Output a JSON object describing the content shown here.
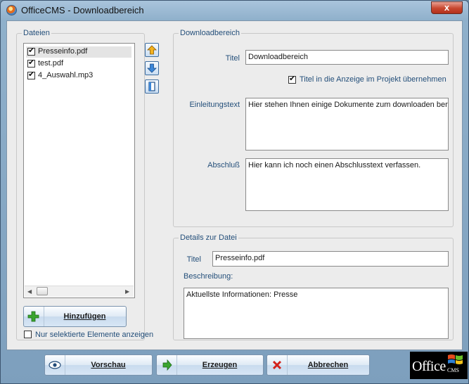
{
  "window": {
    "title": "OfficeCMS - Downloadbereich",
    "close_glyph": "x"
  },
  "files_group": {
    "label": "Dateien",
    "items": [
      {
        "name": "Presseinfo.pdf",
        "checked": true,
        "selected": true
      },
      {
        "name": "test.pdf",
        "checked": true,
        "selected": false
      },
      {
        "name": "4_Auswahl.mp3",
        "checked": true,
        "selected": false
      }
    ],
    "add_button": "Hinzufügen",
    "only_selected_label": "Nur selektierte Elemente anzeigen",
    "only_selected_checked": false,
    "icons": [
      "arrow-up-icon",
      "arrow-down-icon",
      "page-icon"
    ]
  },
  "download_group": {
    "label": "Downloadbereich",
    "title_label": "Titel",
    "title_value": "Downloadbereich",
    "take_title_label": "Titel in die Anzeige im Projekt übernehmen",
    "take_title_checked": true,
    "intro_label": "Einleitungstext",
    "intro_value": "Hier stehen Ihnen einige Dokumente zum downloaden bereit",
    "closing_label": "Abschluß",
    "closing_value": "Hier kann ich noch einen Abschlusstext verfassen."
  },
  "details_group": {
    "label": "Details zur Datei",
    "title_label": "Titel",
    "title_value": "Presseinfo.pdf",
    "desc_label": "Beschreibung:",
    "desc_value": "Aktuellste Informationen: Presse"
  },
  "footer": {
    "preview_button": "Vorschau",
    "generate_button": "Erzeugen",
    "cancel_button": "Abbrechen",
    "logo_text": "Office",
    "logo_sub": "CMS"
  },
  "colors": {
    "label_blue": "#244f7a",
    "title_bar": "#a9c4dc",
    "close_red": "#c8472f"
  }
}
